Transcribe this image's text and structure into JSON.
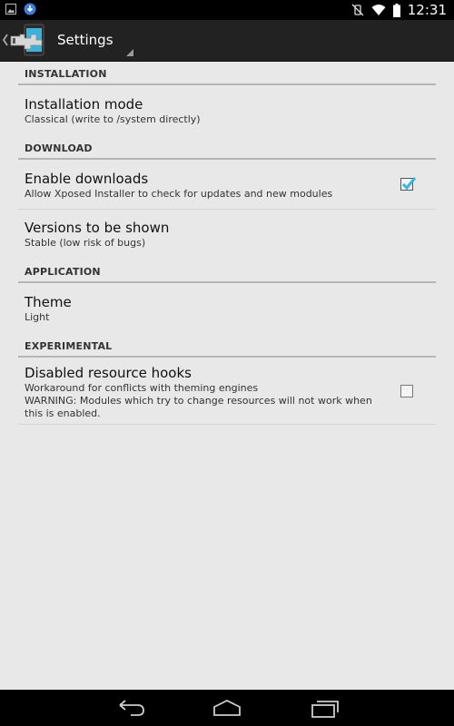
{
  "status_bar": {
    "time": "12:31",
    "icons_left": [
      "image-icon",
      "download-icon"
    ],
    "icons_right": [
      "vibrate-off-icon",
      "wifi-icon",
      "battery-icon"
    ]
  },
  "action_bar": {
    "title": "Settings",
    "app_icon": "xposed-app-icon"
  },
  "sections": [
    {
      "header": "INSTALLATION",
      "items": [
        {
          "title": "Installation mode",
          "summary": "Classical (write to /system directly)"
        }
      ]
    },
    {
      "header": "DOWNLOAD",
      "items": [
        {
          "title": "Enable downloads",
          "summary": "Allow Xposed Installer to check for updates and new modules",
          "checked": true
        },
        {
          "title": "Versions to be shown",
          "summary": "Stable (low risk of bugs)"
        }
      ]
    },
    {
      "header": "APPLICATION",
      "items": [
        {
          "title": "Theme",
          "summary": "Light"
        }
      ]
    },
    {
      "header": "EXPERIMENTAL",
      "items": [
        {
          "title": "Disabled resource hooks",
          "summary_line1": "Workaround for conflicts with theming engines",
          "summary_line2": "WARNING: Modules which try to change resources will not work when this is enabled.",
          "checked": false
        }
      ]
    }
  ],
  "nav_bar": {
    "buttons": [
      "back-icon",
      "home-icon",
      "recents-icon"
    ]
  },
  "colors": {
    "accent": "#33b5e5",
    "background": "#e8e8e8",
    "action_bar": "#222222"
  }
}
